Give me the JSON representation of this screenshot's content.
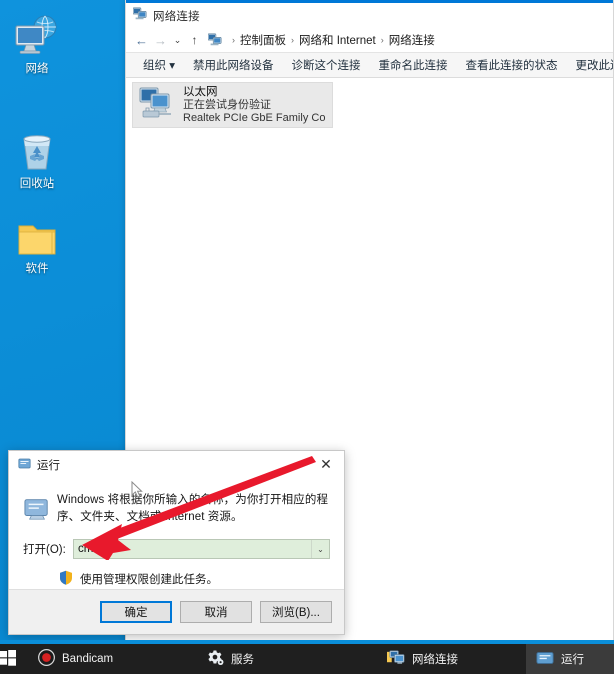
{
  "desktop": {
    "background_color": "#0a8ed9",
    "icons": [
      {
        "label": "网络",
        "icon": "network-globe-icon"
      },
      {
        "label": "回收站",
        "icon": "recycle-bin-icon"
      },
      {
        "label": "软件",
        "icon": "folder-icon"
      }
    ]
  },
  "explorer": {
    "title": "网络连接",
    "title_icon": "network-connections-icon",
    "nav": {
      "back": "←",
      "forward": "→",
      "recent": "⌄",
      "up": "↑"
    },
    "breadcrumb": {
      "icon": "network-connections-icon",
      "separator": "›",
      "items": [
        "控制面板",
        "网络和 Internet",
        "网络连接"
      ]
    },
    "toolbar": [
      {
        "label": "组织 ▾",
        "name": "organize"
      },
      {
        "label": "禁用此网络设备",
        "name": "disable-device"
      },
      {
        "label": "诊断这个连接",
        "name": "diagnose-connection"
      },
      {
        "label": "重命名此连接",
        "name": "rename-connection"
      },
      {
        "label": "查看此连接的状态",
        "name": "view-status"
      },
      {
        "label": "更改此连接的设置",
        "name": "change-settings"
      }
    ],
    "connections": [
      {
        "name": "以太网",
        "status": "正在尝试身份验证",
        "adapter": "Realtek PCIe GbE Family Contr...",
        "icon": "ethernet-adapter-icon",
        "selected": true
      }
    ]
  },
  "run_dialog": {
    "title": "运行",
    "title_icon": "run-dialog-icon",
    "close_label": "✕",
    "description": "Windows 将根据你所输入的名称，为你打开相应的程序、文件夹、文档或 Internet 资源。",
    "open_label": "打开(O):",
    "open_value": "cmd",
    "open_placeholder": "",
    "dropdown_arrow": "⌄",
    "uac_note": "使用管理权限创建此任务。",
    "uac_icon": "shield-icon",
    "buttons": [
      {
        "label": "确定",
        "name": "ok-button",
        "default": true
      },
      {
        "label": "取消",
        "name": "cancel-button",
        "default": false
      },
      {
        "label": "浏览(B)...",
        "name": "browse-button",
        "default": false
      }
    ]
  },
  "annotation": {
    "arrow_color": "#e8192c",
    "arrow_from": "310,460",
    "arrow_to": "96,545"
  },
  "taskbar": {
    "background_color": "#1f1f1f",
    "accent_color": "#0a8ed9",
    "start": {
      "name": "start-button",
      "icon": "windows-logo-icon"
    },
    "items": [
      {
        "label": "Bandicam",
        "icon": "bandicam-icon",
        "active": false
      },
      {
        "label": "服务",
        "icon": "services-gear-icon",
        "active": false
      },
      {
        "label": "网络连接",
        "icon": "network-connections-icon",
        "active": false
      },
      {
        "label": "运行",
        "icon": "run-dialog-icon",
        "active": true
      }
    ]
  }
}
